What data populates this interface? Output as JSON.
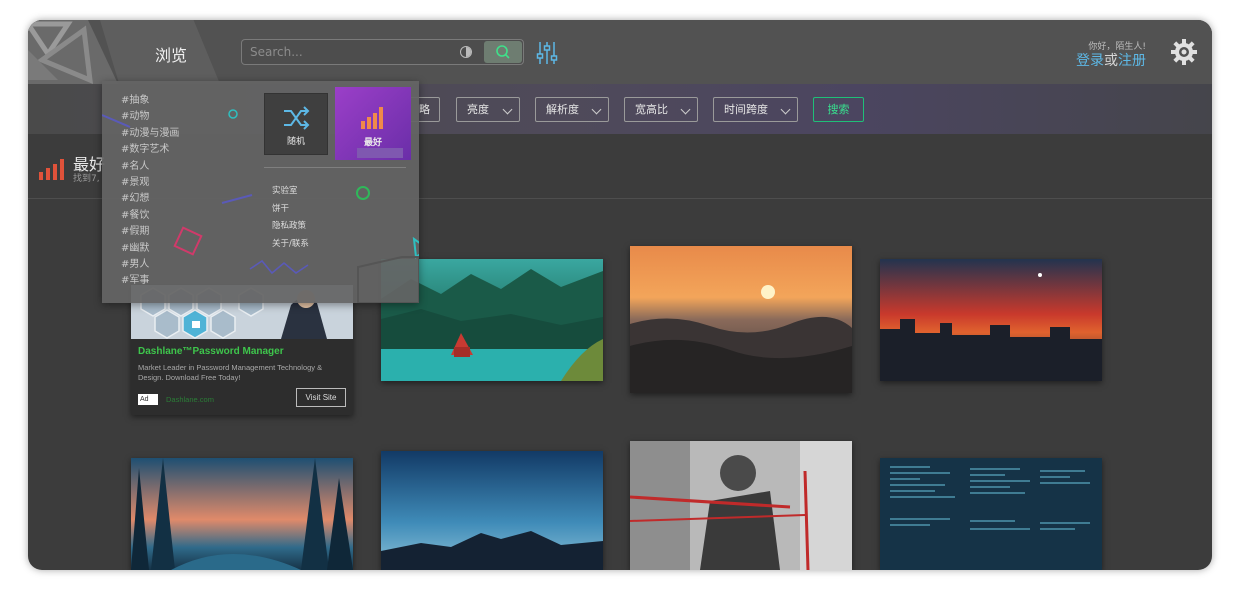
{
  "header": {
    "browse_label": "浏览",
    "search_placeholder": "Search...",
    "greeting": "你好，陌生人!",
    "login_label": "登录",
    "or_label": "或",
    "register_label": "注册"
  },
  "filters": {
    "partial_label": "略",
    "items": [
      "亮度",
      "解析度",
      "宽高比",
      "时间跨度"
    ],
    "search_label": "搜索"
  },
  "section": {
    "title": "最好",
    "count_prefix": "找到7,"
  },
  "dropdown": {
    "categories": [
      "#抽象",
      "#动物",
      "#动漫与漫画",
      "#数字艺术",
      "#名人",
      "#景观",
      "#幻想",
      "#餐饮",
      "#假期",
      "#幽默",
      "#男人",
      "#军事"
    ],
    "random_label": "随机",
    "best_label": "最好",
    "links": [
      "实验室",
      "饼干",
      "隐私政策",
      "关于/联系"
    ]
  },
  "ad": {
    "title": "Dashlane™Password Manager",
    "description": "Market Leader in Password Management Technology & Design. Download Free Today!",
    "badge": "Ad",
    "domain": "Dashlane.com",
    "visit_label": "Visit Site"
  },
  "colors": {
    "accent_green": "#38e08f",
    "link_blue": "#5db8e6",
    "best_purple": "#8a3cc0",
    "section_icon_red": "#e0523a"
  }
}
